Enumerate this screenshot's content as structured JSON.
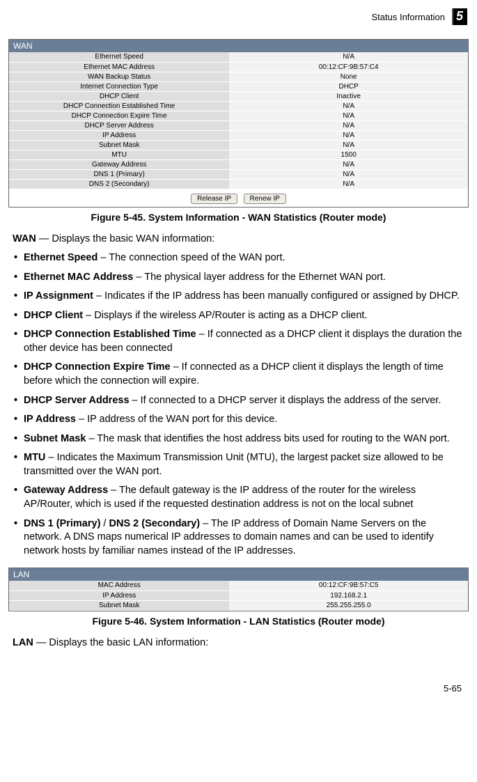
{
  "header": {
    "section_label": "Status Information",
    "chapter_number": "5"
  },
  "wan_panel": {
    "title": "WAN",
    "rows": [
      {
        "key": "Ethernet Speed",
        "val": "N/A"
      },
      {
        "key": "Ethernet MAC Address",
        "val": "00:12:CF:9B:57:C4"
      },
      {
        "key": "WAN Backup Status",
        "val": "None"
      },
      {
        "key": "Internet Connection Type",
        "val": "DHCP"
      },
      {
        "key": "DHCP Client",
        "val": "Inactive"
      },
      {
        "key": "DHCP Connection Established Time",
        "val": "N/A"
      },
      {
        "key": "DHCP Connection Expire Time",
        "val": "N/A"
      },
      {
        "key": "DHCP Server Address",
        "val": "N/A"
      },
      {
        "key": "IP Address",
        "val": "N/A"
      },
      {
        "key": "Subnet Mask",
        "val": "N/A"
      },
      {
        "key": "MTU",
        "val": "1500"
      },
      {
        "key": "Gateway Address",
        "val": "N/A"
      },
      {
        "key": "DNS 1 (Primary)",
        "val": "N/A"
      },
      {
        "key": "DNS 2 (Secondary)",
        "val": "N/A"
      }
    ],
    "buttons": {
      "release": "Release IP",
      "renew": "Renew IP"
    }
  },
  "captions": {
    "wan": "Figure 5-45.   System Information - WAN Statistics (Router mode)",
    "lan": "Figure 5-46.   System Information - LAN Statistics (Router mode)"
  },
  "wan_intro_term": "WAN",
  "wan_intro_rest": " — Displays the basic WAN information:",
  "bullets": [
    {
      "term": "Ethernet Speed",
      "rest": " – The connection speed of the WAN port."
    },
    {
      "term": "Ethernet MAC Address",
      "rest": " – The physical layer address for the Ethernet WAN port."
    },
    {
      "term": "IP Assignment",
      "rest": " – Indicates if the IP address has been manually configured or assigned by DHCP."
    },
    {
      "term": "DHCP Client",
      "rest": " – Displays if the wireless AP/Router is acting as a DHCP client."
    },
    {
      "term": "DHCP Connection Established Time",
      "rest": " – If connected as a DHCP client it displays the duration the other device has been connected"
    },
    {
      "term": "DHCP Connection Expire Time",
      "rest": " – If connected as a DHCP client it displays the length of time before which the connection will expire."
    },
    {
      "term": "DHCP Server Address",
      "rest": " – If connected to a DHCP server it displays the address of the server."
    },
    {
      "term": "IP Address",
      "rest": " – IP address of the WAN port for this device."
    },
    {
      "term": "Subnet Mask",
      "rest": " – The mask that identifies the host address bits used for routing to the WAN port."
    },
    {
      "term": "MTU",
      "rest": " – Indicates the Maximum Transmission Unit (MTU), the largest packet size allowed to be transmitted over the WAN port."
    },
    {
      "term": "Gateway Address",
      "rest": " – The default gateway is the IP address of the router for the wireless AP/Router, which is used if the requested destination address is not on the local subnet"
    }
  ],
  "dns_bullet": {
    "term1": "DNS 1 (Primary)",
    "sep": " / ",
    "term2": "DNS 2 (Secondary)",
    "rest": " – The IP address of Domain Name Servers on the network. A DNS maps numerical IP addresses to domain names and can be used to identify network hosts by familiar names instead of the IP addresses."
  },
  "lan_panel": {
    "title": "LAN",
    "rows": [
      {
        "key": "MAC Address",
        "val": "00:12:CF:9B:57:C5"
      },
      {
        "key": "IP Address",
        "val": "192.168.2.1"
      },
      {
        "key": "Subnet Mask",
        "val": "255.255.255.0"
      }
    ]
  },
  "lan_intro_term": "LAN",
  "lan_intro_rest": " — Displays the basic LAN information:",
  "footer": {
    "page": "5-65"
  }
}
